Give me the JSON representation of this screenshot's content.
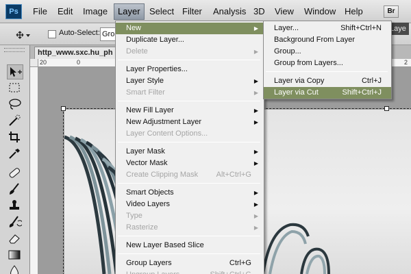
{
  "app": {
    "logo": "Ps"
  },
  "menubar": {
    "items": [
      "File",
      "Edit",
      "Image",
      "Layer",
      "Select",
      "Filter",
      "Analysis",
      "3D",
      "View",
      "Window",
      "Help"
    ],
    "active": "Layer",
    "bridge_label": "Br"
  },
  "options": {
    "auto_select_label": "Auto-Select:",
    "auto_select_value": "Grou",
    "workspace_label": "Laye"
  },
  "document": {
    "tab_title": "http_www.sxc.hu_ph",
    "ruler_h": [
      "20",
      "0",
      "2"
    ],
    "ruler_v": []
  },
  "layer_menu": {
    "items": [
      {
        "label": "New",
        "state": "highlighted",
        "submenu": true
      },
      {
        "label": "Duplicate Layer...",
        "state": "enabled"
      },
      {
        "label": "Delete",
        "state": "disabled",
        "submenu": true
      },
      {
        "sep": true
      },
      {
        "label": "Layer Properties...",
        "state": "enabled"
      },
      {
        "label": "Layer Style",
        "state": "enabled",
        "submenu": true
      },
      {
        "label": "Smart Filter",
        "state": "disabled",
        "submenu": true
      },
      {
        "sep": true
      },
      {
        "label": "New Fill Layer",
        "state": "enabled",
        "submenu": true
      },
      {
        "label": "New Adjustment Layer",
        "state": "enabled",
        "submenu": true
      },
      {
        "label": "Layer Content Options...",
        "state": "disabled"
      },
      {
        "sep": true
      },
      {
        "label": "Layer Mask",
        "state": "enabled",
        "submenu": true
      },
      {
        "label": "Vector Mask",
        "state": "enabled",
        "submenu": true
      },
      {
        "label": "Create Clipping Mask",
        "state": "disabled",
        "shortcut": "Alt+Ctrl+G"
      },
      {
        "sep": true
      },
      {
        "label": "Smart Objects",
        "state": "enabled",
        "submenu": true
      },
      {
        "label": "Video Layers",
        "state": "enabled",
        "submenu": true
      },
      {
        "label": "Type",
        "state": "disabled",
        "submenu": true
      },
      {
        "label": "Rasterize",
        "state": "disabled",
        "submenu": true
      },
      {
        "sep": true
      },
      {
        "label": "New Layer Based Slice",
        "state": "enabled"
      },
      {
        "sep": true
      },
      {
        "label": "Group Layers",
        "state": "enabled",
        "shortcut": "Ctrl+G"
      },
      {
        "label": "Ungroup Layers",
        "state": "disabled",
        "shortcut": "Shift+Ctrl+G"
      }
    ]
  },
  "new_submenu": {
    "items": [
      {
        "label": "Layer...",
        "shortcut": "Shift+Ctrl+N",
        "state": "enabled"
      },
      {
        "label": "Background From Layer",
        "state": "enabled"
      },
      {
        "label": "Group...",
        "state": "enabled"
      },
      {
        "label": "Group from Layers...",
        "state": "enabled"
      },
      {
        "sep": true
      },
      {
        "label": "Layer via Copy",
        "shortcut": "Ctrl+J",
        "state": "enabled"
      },
      {
        "label": "Layer via Cut",
        "shortcut": "Shift+Ctrl+J",
        "state": "highlighted"
      }
    ]
  },
  "tools": [
    "move-tool",
    "marquee-tool",
    "lasso-tool",
    "quick-selection-tool",
    "crop-tool",
    "eyedropper-tool",
    "healing-brush-tool",
    "brush-tool",
    "clone-stamp-tool",
    "history-brush-tool",
    "eraser-tool",
    "gradient-tool",
    "blur-tool"
  ],
  "colors": {
    "menu_highlight": "#7f8f5f",
    "disabled_text": "#a5a5a5"
  }
}
